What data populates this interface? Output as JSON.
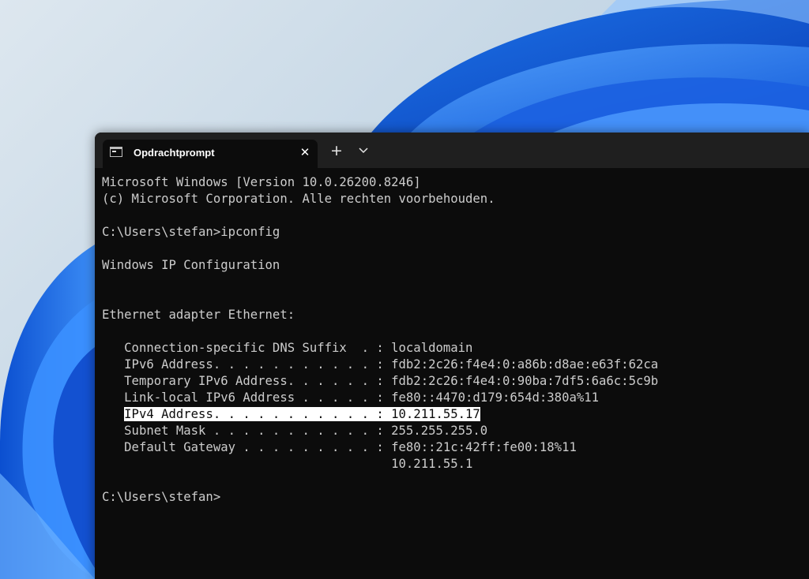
{
  "window": {
    "tab_title": "Opdrachtprompt",
    "tab_icon": "command-prompt-icon",
    "close_icon": "close-icon",
    "new_tab_icon": "plus-icon",
    "dropdown_icon": "chevron-down-icon"
  },
  "console": {
    "lines": [
      "Microsoft Windows [Version 10.0.26200.8246]",
      "(c) Microsoft Corporation. Alle rechten voorbehouden.",
      "",
      "C:\\Users\\stefan>ipconfig",
      "",
      "Windows IP Configuration",
      "",
      "",
      "Ethernet adapter Ethernet:",
      "",
      "   Connection-specific DNS Suffix  . : localdomain",
      "   IPv6 Address. . . . . . . . . . . : fdb2:2c26:f4e4:0:a86b:d8ae:e63f:62ca",
      "   Temporary IPv6 Address. . . . . . : fdb2:2c26:f4e4:0:90ba:7df5:6a6c:5c9b",
      "   Link-local IPv6 Address . . . . . : fe80::4470:d179:654d:380a%11",
      "   IPv4 Address. . . . . . . . . . . : 10.211.55.17",
      "   Subnet Mask . . . . . . . . . . . : 255.255.255.0",
      "   Default Gateway . . . . . . . . . : fe80::21c:42ff:fe00:18%11",
      "                                       10.211.55.1",
      "",
      "C:\\Users\\stefan>"
    ],
    "highlighted_line_index": 14
  },
  "colors": {
    "console_background": "#0c0c0c",
    "console_text": "#cccccc",
    "tab_bar": "#1f1f1f",
    "highlight_background": "#ffffff",
    "highlight_text": "#0c0c0c"
  }
}
